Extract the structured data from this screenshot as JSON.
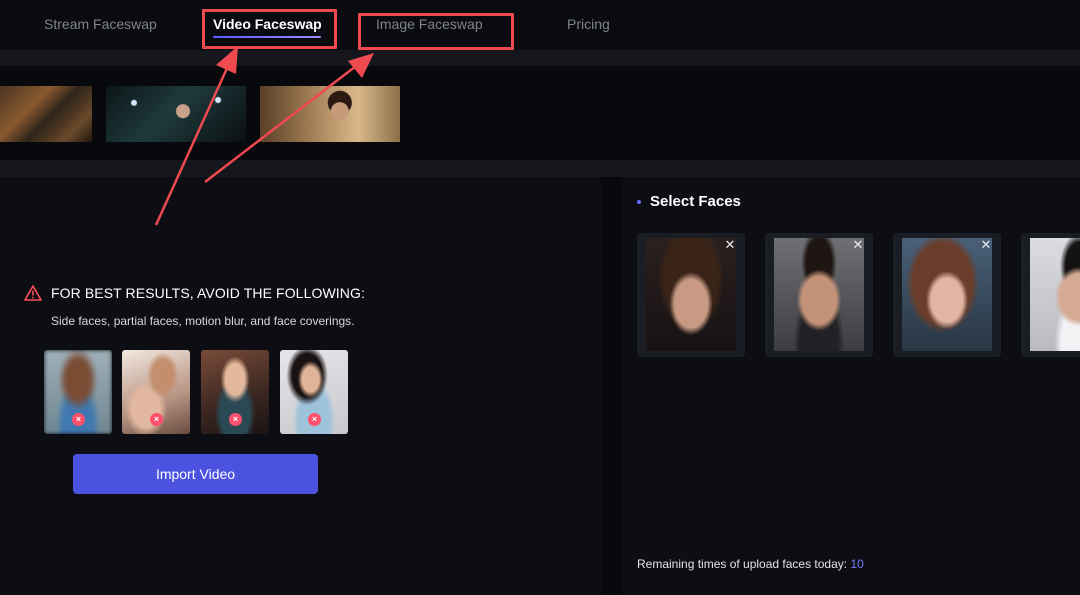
{
  "nav": {
    "tabs": [
      {
        "label": "Stream Faceswap",
        "active": false
      },
      {
        "label": "Video Faceswap",
        "active": true
      },
      {
        "label": "Image Faceswap",
        "active": false
      },
      {
        "label": "Pricing",
        "active": false
      }
    ],
    "accent_color": "#5b5cff"
  },
  "templates": {
    "thumbnails": [
      "video-template-1",
      "video-template-2",
      "video-template-3"
    ]
  },
  "upload_panel": {
    "warning_icon": "warning-triangle-icon",
    "warning_title": "FOR BEST RESULTS, AVOID THE FOLLOWING:",
    "warning_desc": "Side faces, partial faces, motion blur, and face coverings.",
    "bad_examples": [
      "blurred-face",
      "partial-face",
      "covered-face",
      "sunglasses-face"
    ],
    "bad_example_mark": "×",
    "import_button": "Import Video",
    "button_color": "#4b52e0"
  },
  "faces_panel": {
    "title": "Select Faces",
    "faces": [
      "face-1",
      "face-2",
      "face-3",
      "face-4"
    ],
    "close_symbol": "✕",
    "remaining_label": "Remaining times of upload faces today:",
    "remaining_count": "10"
  },
  "annotation": {
    "highlight_color": "#ef4a4f"
  }
}
